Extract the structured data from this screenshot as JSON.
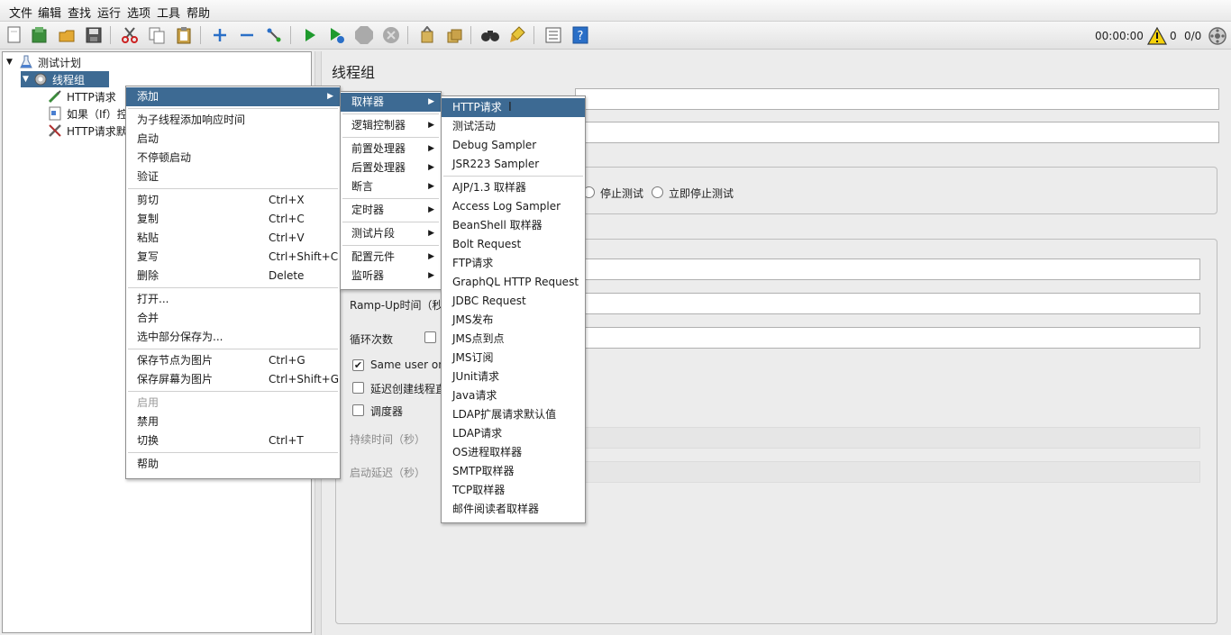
{
  "menubar": [
    "文件",
    "编辑",
    "查找",
    "运行",
    "选项",
    "工具",
    "帮助"
  ],
  "toolbar": {
    "timer": "00:00:00",
    "warning_count": "0",
    "thread_count": "0/0"
  },
  "tree": {
    "items": [
      {
        "label": "测试计划"
      },
      {
        "label": "线程组"
      },
      {
        "label": "HTTP请求"
      },
      {
        "label": "如果（If）控"
      },
      {
        "label": "HTTP请求默"
      }
    ]
  },
  "main": {
    "title": "线程组",
    "radio_stop_test": "停止测试",
    "radio_stop_now": "立即停止测试",
    "rampup_label": "Ramp-Up时间（秒",
    "loop_label": "循环次数",
    "same_user_label": "Same user on",
    "delay_create_label": "延迟创建线程直",
    "scheduler_label": "调度器",
    "duration_label": "持续时间（秒）",
    "startup_delay_label": "启动延迟（秒）"
  },
  "context_menu": {
    "items": [
      {
        "label": "添加",
        "shortcut": ""
      },
      {
        "label": "为子线程添加响应时间",
        "shortcut": ""
      },
      {
        "label": "启动",
        "shortcut": ""
      },
      {
        "label": "不停顿启动",
        "shortcut": ""
      },
      {
        "label": "验证",
        "shortcut": ""
      },
      {
        "label": "剪切",
        "shortcut": "Ctrl+X"
      },
      {
        "label": "复制",
        "shortcut": "Ctrl+C"
      },
      {
        "label": "粘贴",
        "shortcut": "Ctrl+V"
      },
      {
        "label": "复写",
        "shortcut": "Ctrl+Shift+C"
      },
      {
        "label": "删除",
        "shortcut": "Delete"
      },
      {
        "label": "打开...",
        "shortcut": ""
      },
      {
        "label": "合并",
        "shortcut": ""
      },
      {
        "label": "选中部分保存为...",
        "shortcut": ""
      },
      {
        "label": "保存节点为图片",
        "shortcut": "Ctrl+G"
      },
      {
        "label": "保存屏幕为图片",
        "shortcut": "Ctrl+Shift+G"
      },
      {
        "label": "启用",
        "shortcut": ""
      },
      {
        "label": "禁用",
        "shortcut": ""
      },
      {
        "label": "切换",
        "shortcut": "Ctrl+T"
      },
      {
        "label": "帮助",
        "shortcut": ""
      }
    ]
  },
  "add_submenu": {
    "items": [
      "取样器",
      "逻辑控制器",
      "前置处理器",
      "后置处理器",
      "断言",
      "定时器",
      "测试片段",
      "配置元件",
      "监听器"
    ]
  },
  "sampler_submenu": {
    "items": [
      "HTTP请求",
      "测试活动",
      "Debug Sampler",
      "JSR223 Sampler",
      "AJP/1.3 取样器",
      "Access Log Sampler",
      "BeanShell 取样器",
      "Bolt Request",
      "FTP请求",
      "GraphQL HTTP Request",
      "JDBC Request",
      "JMS发布",
      "JMS点到点",
      "JMS订阅",
      "JUnit请求",
      "Java请求",
      "LDAP扩展请求默认值",
      "LDAP请求",
      "OS进程取样器",
      "SMTP取样器",
      "TCP取样器",
      "邮件阅读者取样器"
    ]
  },
  "colors": {
    "selection": "#3d6a93",
    "play_green": "#1f9a2e"
  },
  "icons": {
    "checkbox_check": "✔",
    "submenu_arrow": "▶",
    "tree_expand": "▼"
  }
}
